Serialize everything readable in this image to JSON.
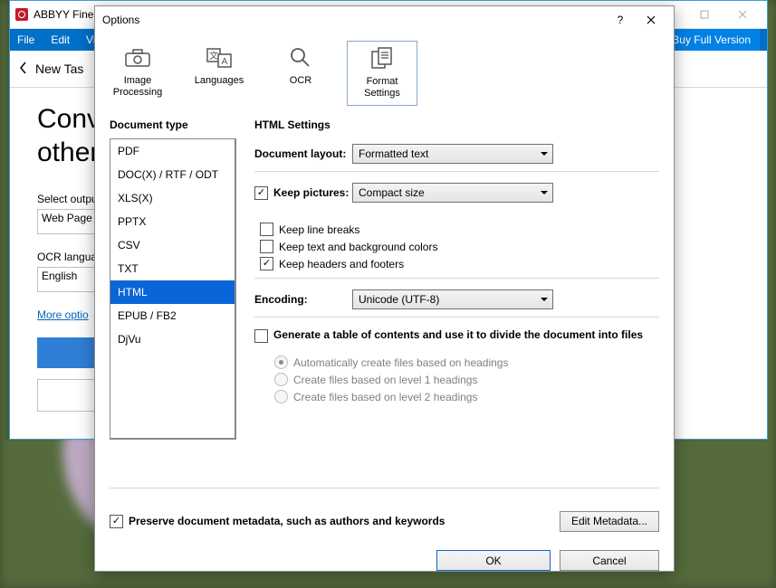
{
  "main_window": {
    "title": "ABBYY Fine",
    "menus": {
      "file": "File",
      "edit": "Edit",
      "view": "Vi"
    },
    "buy": "Buy Full Version",
    "new_task": "New Tas",
    "heading_line1": "Conve",
    "heading_line2": "other",
    "output_label": "Select outpu",
    "output_value": "Web Page (",
    "ocr_lang_label": "OCR langua",
    "ocr_lang_value": "English",
    "more_options": "More optio"
  },
  "dialog": {
    "title": "Options",
    "tabs": {
      "image_processing": "Image\nProcessing",
      "languages": "Languages",
      "ocr": "OCR",
      "format_settings": "Format\nSettings"
    },
    "doc_type_label": "Document type",
    "doc_types": [
      "PDF",
      "DOC(X) / RTF / ODT",
      "XLS(X)",
      "PPTX",
      "CSV",
      "TXT",
      "HTML",
      "EPUB / FB2",
      "DjVu"
    ],
    "doc_type_selected": "HTML",
    "settings_title": "HTML Settings",
    "layout_label": "Document layout:",
    "layout_value": "Formatted text",
    "keep_pictures_label": "Keep pictures:",
    "keep_pictures_value": "Compact size",
    "keep_pictures_checked": true,
    "keep_line_breaks_label": "Keep line breaks",
    "keep_line_breaks_checked": false,
    "keep_colors_label": "Keep text and background colors",
    "keep_colors_checked": false,
    "keep_headers_label": "Keep headers and footers",
    "keep_headers_checked": true,
    "encoding_label": "Encoding:",
    "encoding_value": "Unicode (UTF-8)",
    "toc_label": "Generate a table of contents and use it to divide the document into files",
    "toc_checked": false,
    "toc_options": {
      "auto": "Automatically create files based on headings",
      "lvl1": "Create files based on level 1 headings",
      "lvl2": "Create files based on level 2 headings",
      "selected": "auto"
    },
    "preserve_metadata_label": "Preserve document metadata, such as authors and keywords",
    "preserve_metadata_checked": true,
    "edit_metadata": "Edit Metadata...",
    "ok": "OK",
    "cancel": "Cancel"
  }
}
